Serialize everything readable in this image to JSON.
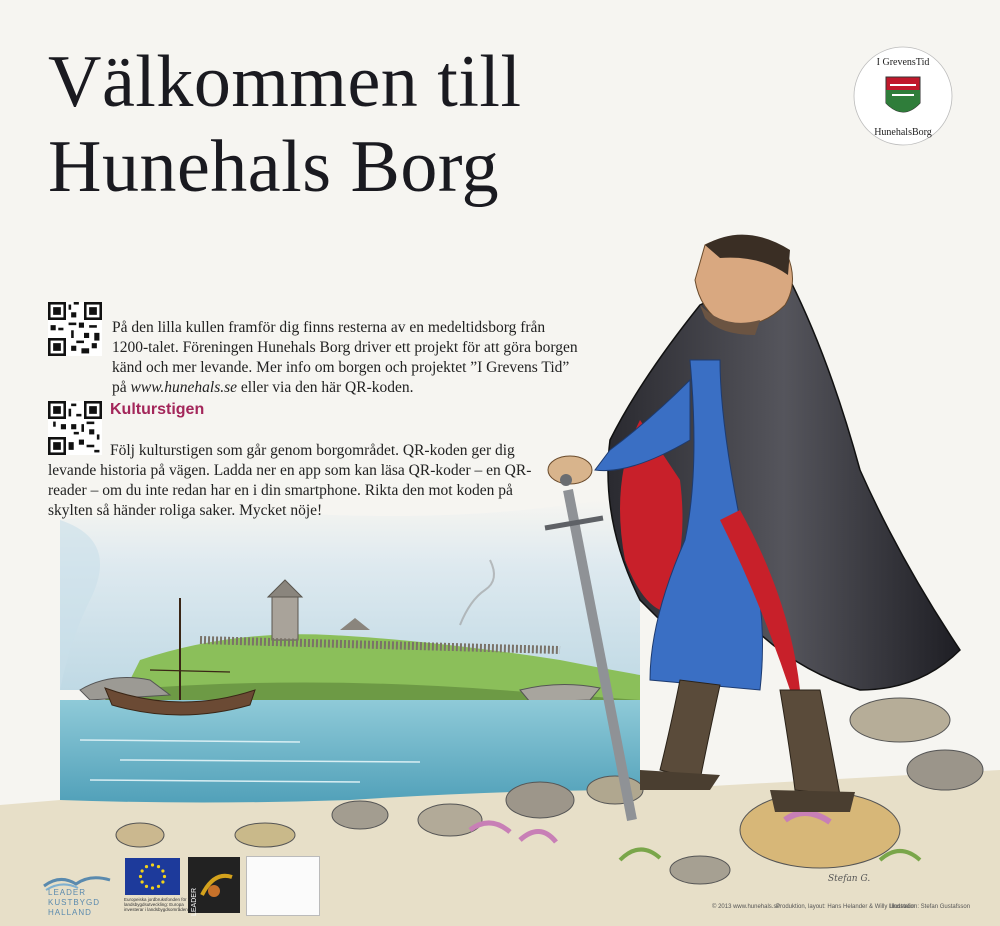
{
  "title": {
    "line1": "Välkommen till",
    "line2": "Hunehals Borg"
  },
  "logo": {
    "text_top": "I GrevensTid",
    "text_bottom": "HunehalsBorg",
    "colors": {
      "red": "#c0182b",
      "green": "#2f7d3a"
    }
  },
  "intro": {
    "text": "På den lilla kullen framför dig finns resterna av en medeltidsborg från 1200-talet. Föreningen Hunehals Borg driver ett projekt för att göra borgen känd och mer levande. Mer info om borgen och projektet ”I Grevens Tid” på ",
    "url": "www.hunehals.se",
    "text_end": " eller via den här QR-koden."
  },
  "kulturstigen": {
    "heading": "Kulturstigen",
    "text": "Följ kulturstigen som går genom borgområdet. QR-koden ger dig levande historia på vägen. Ladda ner en app som kan läsa QR-koder – en QR-reader – om du inte redan har en i din smartphone. Rikta den mot koden på skylten så händer roliga saker. Mycket nöje!"
  },
  "footer": {
    "copyright": "© 2013  www.hunehals.se",
    "production": "Produktion, layout: Hans Helander & Willy Lindström",
    "illustration": "Illustration: Stefan Gustafsson"
  },
  "sponsors": {
    "leader_kust": [
      "LEADER",
      "KUSTBYGD",
      "HALLAND"
    ],
    "eu_text": "Europeiska jordbruksfonden för landsbygdsutveckling: Europa investerar i landsbygdsområden",
    "leader_vertical": "LEADER"
  },
  "signature": "Stefan G.",
  "colors": {
    "accent": "#a3265a",
    "cloak_red": "#c8202a",
    "tunic_blue": "#3a6fc4",
    "sea": "#6fb3c8",
    "grass": "#8bbf5a"
  }
}
